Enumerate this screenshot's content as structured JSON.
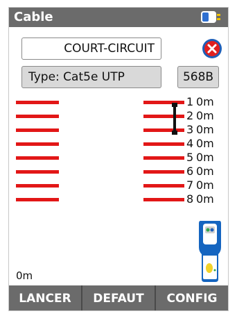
{
  "window": {
    "title": "Cable"
  },
  "status": {
    "result": "COURT-CIRCUIT"
  },
  "cable": {
    "type_text": "Type: Cat5e UTP",
    "wiring_standard": "568B"
  },
  "pairs": [
    {
      "num": "1",
      "length": "0m"
    },
    {
      "num": "2",
      "length": "0m"
    },
    {
      "num": "3",
      "length": "0m"
    },
    {
      "num": "4",
      "length": "0m"
    },
    {
      "num": "5",
      "length": "0m"
    },
    {
      "num": "6",
      "length": "0m"
    },
    {
      "num": "7",
      "length": "0m"
    },
    {
      "num": "8",
      "length": "0m"
    }
  ],
  "scale": {
    "start_label": "0m"
  },
  "softkeys": {
    "left": "LANCER",
    "center": "DEFAUT",
    "right": "CONFIG"
  },
  "colors": {
    "wire": "#e21717",
    "bar": "#6b6b6b",
    "close": "#e02020",
    "tester_body": "#1565c0"
  }
}
